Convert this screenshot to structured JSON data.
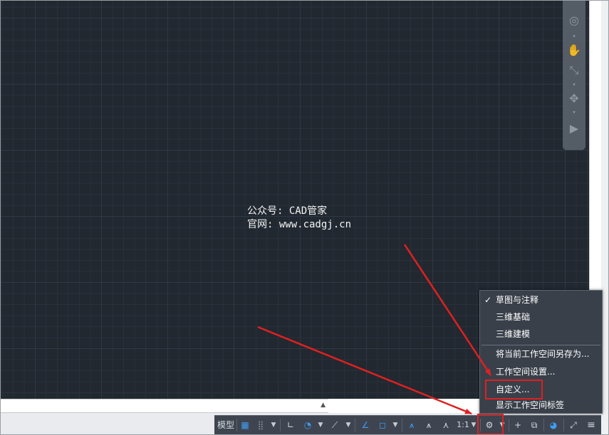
{
  "watermark": {
    "line1": "公众号: CAD管家",
    "line2": "官网: www.cadgj.cn"
  },
  "navbar": {
    "icons": [
      "steering-wheel-icon",
      "pan-hand-icon",
      "zoom-extents-icon",
      "orbit-icon",
      "showmotion-icon"
    ]
  },
  "statusbar": {
    "model_label": "模型",
    "scale_label": "1:1",
    "icons": [
      "grid-icon",
      "snap-icon",
      "ortho-icon",
      "polar-icon",
      "isodraft-icon",
      "osnap-track-icon",
      "osnap-icon",
      "annotation-visibility-icon",
      "autoscale-icon",
      "annotation-scale-icon",
      "workspace-gear-icon",
      "plus-icon",
      "isolate-icon",
      "hardware-accel-icon",
      "clean-screen-icon",
      "customize-menu-icon"
    ]
  },
  "workspace_menu": {
    "items": [
      {
        "label": "草图与注释",
        "checked": true
      },
      {
        "label": "三维基础",
        "checked": false
      },
      {
        "label": "三维建模",
        "checked": false
      },
      {
        "label": "将当前工作空间另存为...",
        "checked": false
      },
      {
        "label": "工作空间设置...",
        "checked": false
      },
      {
        "label": "自定义...",
        "checked": false
      },
      {
        "label": "显示工作空间标签",
        "checked": false
      }
    ],
    "check_mark": "✓"
  },
  "colors": {
    "canvas": "#212830",
    "statusbar": "#3e4550",
    "menu": "#39404a",
    "highlight": "#e02020",
    "accent": "#3f9df7"
  }
}
